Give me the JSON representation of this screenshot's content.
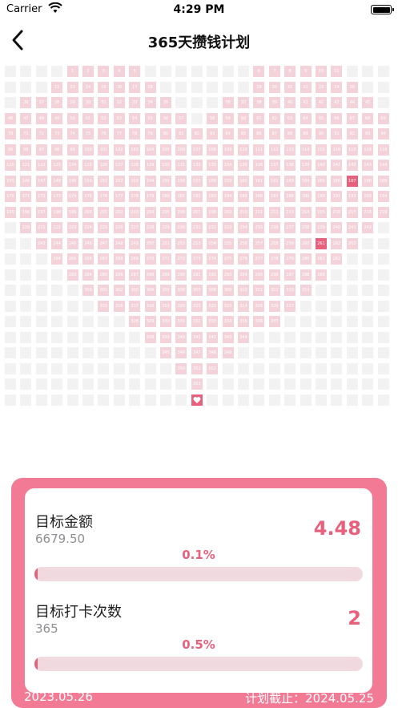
{
  "status_bar": {
    "carrier": "Carrier",
    "time": "4:29 PM"
  },
  "nav": {
    "title": "365天攒钱计划"
  },
  "grid": {
    "total_days": 365,
    "checked_days": [
      167,
      261
    ]
  },
  "goal_amount": {
    "label": "目标金额",
    "target": "6679.50",
    "saved": "4.48",
    "percent_text": "0.1%",
    "progress": 0.001
  },
  "goal_checkins": {
    "label": "目标打卡次数",
    "target": "365",
    "count": "2",
    "percent_text": "0.5%",
    "progress": 0.005
  },
  "footer": {
    "start_date": "2023.05.26",
    "end_label": "计划截止：2024.05.25"
  },
  "colors": {
    "accent": "#e8607c",
    "panel": "#f27a95",
    "cell_day": "#f3d3d9",
    "cell_empty": "#f2f2f2"
  }
}
